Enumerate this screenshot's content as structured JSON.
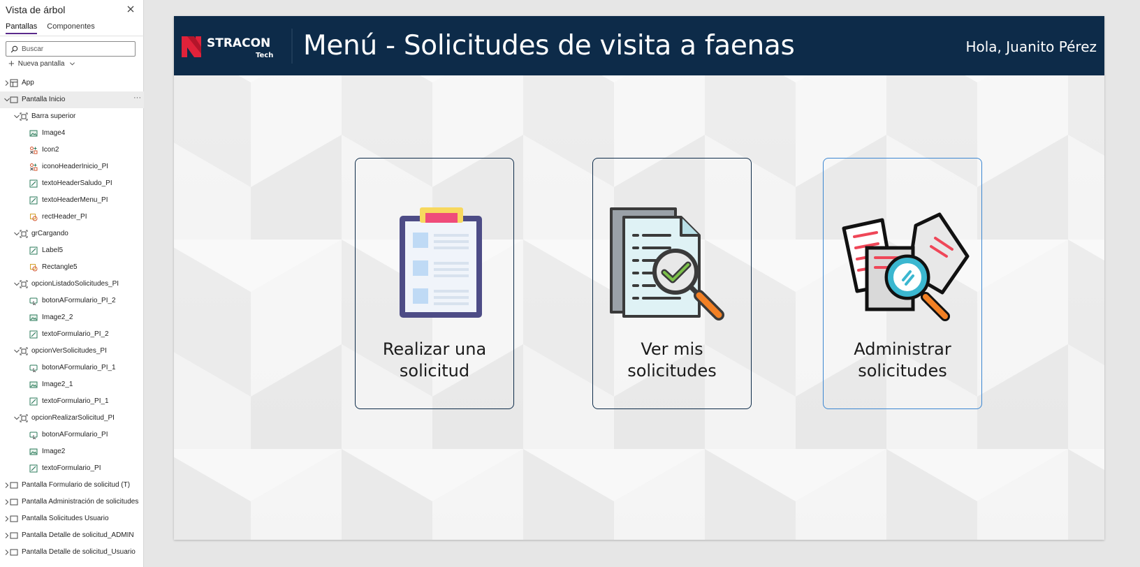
{
  "panel": {
    "title": "Vista de árbol",
    "tabs": [
      {
        "label": "Pantallas",
        "active": true
      },
      {
        "label": "Componentes",
        "active": false
      }
    ],
    "search_placeholder": "Buscar",
    "new_screen_label": "Nueva pantalla",
    "more_glyph": "···"
  },
  "tree": [
    {
      "label": "App",
      "icon": "app-grid-icon",
      "indent": 0,
      "expanded": false
    },
    {
      "label": "Pantalla Inicio",
      "icon": "screen-icon",
      "indent": 0,
      "expanded": true,
      "selected": true
    },
    {
      "label": "Barra superior",
      "icon": "group-icon",
      "indent": 1,
      "expanded": true
    },
    {
      "label": "Image4",
      "icon": "image-icon",
      "indent": 2
    },
    {
      "label": "Icon2",
      "icon": "icons-icon",
      "indent": 2
    },
    {
      "label": "iconoHeaderInicio_PI",
      "icon": "icons-icon",
      "indent": 2
    },
    {
      "label": "textoHeaderSaludo_PI",
      "icon": "label-icon",
      "indent": 2
    },
    {
      "label": "textoHeaderMenu_PI",
      "icon": "label-icon",
      "indent": 2
    },
    {
      "label": "rectHeader_PI",
      "icon": "shape-icon",
      "indent": 2
    },
    {
      "label": "grCargando",
      "icon": "group-icon",
      "indent": 1,
      "expanded": true
    },
    {
      "label": "Label5",
      "icon": "label-icon",
      "indent": 2
    },
    {
      "label": "Rectangle5",
      "icon": "shape-icon",
      "indent": 2
    },
    {
      "label": "opcionListadoSolicitudes_PI",
      "icon": "group-icon",
      "indent": 1,
      "expanded": true
    },
    {
      "label": "botonAFormulario_PI_2",
      "icon": "button-icon",
      "indent": 2
    },
    {
      "label": "Image2_2",
      "icon": "image-icon",
      "indent": 2
    },
    {
      "label": "textoFormulario_PI_2",
      "icon": "label-icon",
      "indent": 2
    },
    {
      "label": "opcionVerSolicitudes_PI",
      "icon": "group-icon",
      "indent": 1,
      "expanded": true
    },
    {
      "label": "botonAFormulario_PI_1",
      "icon": "button-icon",
      "indent": 2
    },
    {
      "label": "Image2_1",
      "icon": "image-icon",
      "indent": 2
    },
    {
      "label": "textoFormulario_PI_1",
      "icon": "label-icon",
      "indent": 2
    },
    {
      "label": "opcionRealizarSolicitud_PI",
      "icon": "group-icon",
      "indent": 1,
      "expanded": true
    },
    {
      "label": "botonAFormulario_PI",
      "icon": "button-icon",
      "indent": 2
    },
    {
      "label": "Image2",
      "icon": "image-icon",
      "indent": 2
    },
    {
      "label": "textoFormulario_PI",
      "icon": "label-icon",
      "indent": 2
    },
    {
      "label": "Pantalla Formulario de solicitud (T)",
      "icon": "screen-icon",
      "indent": 0,
      "expanded": false
    },
    {
      "label": "Pantalla Administración de solicitudes",
      "icon": "screen-icon",
      "indent": 0,
      "expanded": false
    },
    {
      "label": "Pantalla Solicitudes Usuario",
      "icon": "screen-icon",
      "indent": 0,
      "expanded": false
    },
    {
      "label": "Pantalla Detalle de solicitud_ADMIN",
      "icon": "screen-icon",
      "indent": 0,
      "expanded": false
    },
    {
      "label": "Pantalla Detalle de solicitud_Usuario",
      "icon": "screen-icon",
      "indent": 0,
      "expanded": false
    }
  ],
  "app": {
    "logo_text": "STRACON",
    "logo_sub": "Tech",
    "title": "Menú - Solicitudes de visita a faenas",
    "greeting": "Hola, Juanito Pérez",
    "cards": [
      {
        "label_line1": "Realizar una",
        "label_line2": "solicitud",
        "icon": "clipboard-icon"
      },
      {
        "label_line1": "Ver mis",
        "label_line2": "solicitudes",
        "icon": "document-check-search-icon"
      },
      {
        "label_line1": "Administrar",
        "label_line2": "solicitudes",
        "icon": "documents-search-icon"
      }
    ]
  },
  "colors": {
    "header_bg": "#0d2b49",
    "brand_red": "#e0223a",
    "card_border": "#0d2b49",
    "card_border_hover": "#3b86d1",
    "tab_underline": "#5a2a8a"
  }
}
